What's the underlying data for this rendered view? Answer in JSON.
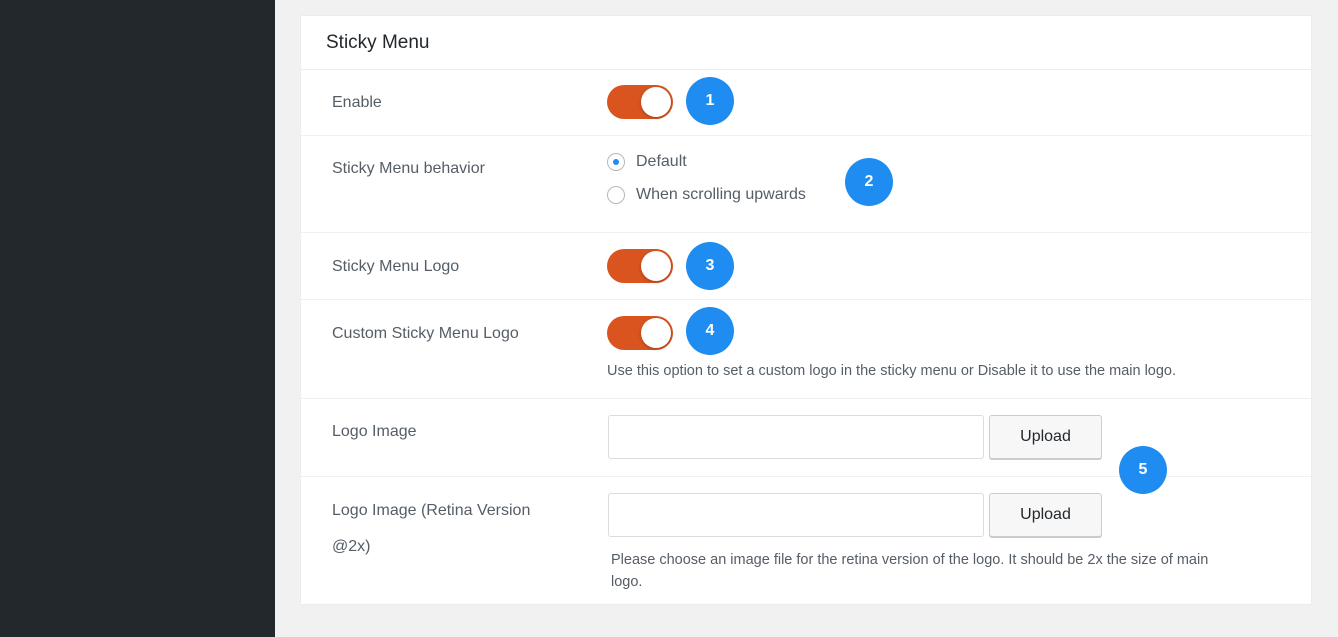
{
  "panel": {
    "title": "Sticky Menu"
  },
  "rows": {
    "enable": {
      "label": "Enable",
      "toggle_on": true,
      "badge": "1"
    },
    "behavior": {
      "label": "Sticky Menu behavior",
      "options": [
        "Default",
        "When scrolling upwards"
      ],
      "selected": "Default",
      "badge": "2"
    },
    "logo": {
      "label": "Sticky Menu Logo",
      "toggle_on": true,
      "badge": "3"
    },
    "custom_logo": {
      "label": "Custom Sticky Menu Logo",
      "toggle_on": true,
      "badge": "4",
      "description": "Use this option to set a custom logo in the sticky menu or Disable it to use the main logo."
    },
    "logo_image": {
      "label": "Logo Image",
      "value": "",
      "upload_label": "Upload"
    },
    "logo_retina": {
      "label_line1": "Logo Image (Retina Version",
      "label_line2": "@2x)",
      "value": "",
      "upload_label": "Upload",
      "description_line1": "Please choose an image file for the retina version of the logo. It should be 2x the size of main",
      "description_line2": "logo."
    },
    "upload_badge": "5"
  },
  "colors": {
    "sidebar": "#23282d",
    "toggle_on": "#d9541e",
    "badge": "#1e8cf0"
  }
}
